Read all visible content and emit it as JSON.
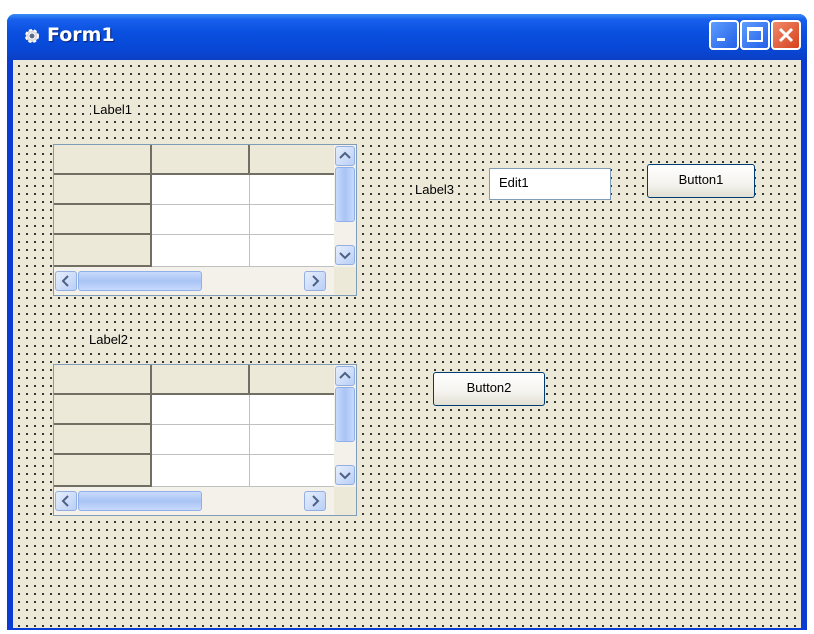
{
  "window": {
    "title": "Form1"
  },
  "labels": {
    "label1": "Label1",
    "label2": "Label2",
    "label3": "Label3"
  },
  "edit1": {
    "value": "Edit1"
  },
  "buttons": {
    "button1": "Button1",
    "button2": "Button2"
  },
  "grids": [
    {
      "name": "grid1",
      "columns": 3,
      "rows": 4,
      "fixed_columns": 1,
      "fixed_rows": 1
    },
    {
      "name": "grid2",
      "columns": 3,
      "rows": 4,
      "fixed_columns": 1,
      "fixed_rows": 1
    }
  ],
  "colors": {
    "form_background": "#ece9d8",
    "title_bar": "#0a50e0",
    "close_button": "#d6411c"
  },
  "icons": {
    "app": "gear-icon",
    "minimize": "minimize-icon",
    "maximize": "maximize-icon",
    "close": "close-icon"
  }
}
